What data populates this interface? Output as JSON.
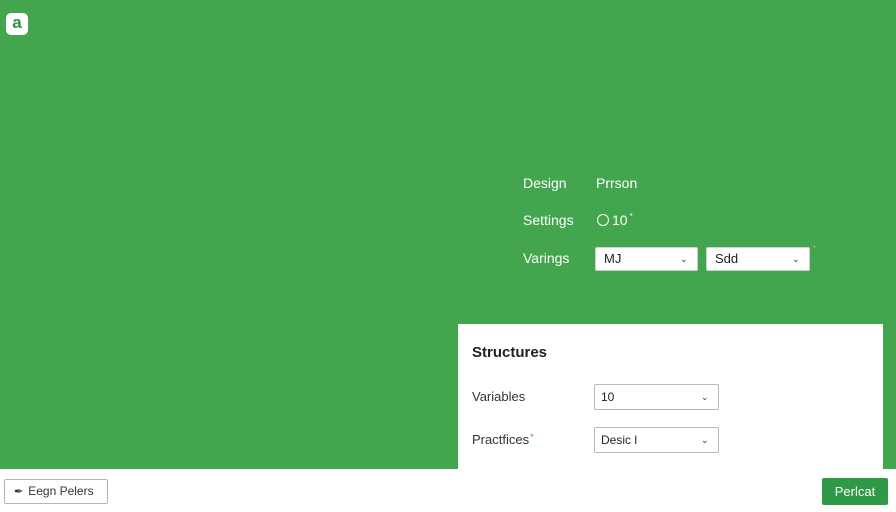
{
  "app": {
    "logo_letter": "a"
  },
  "form": {
    "design_label": "Design",
    "design_value": "Prrson",
    "settings_label": "Settings",
    "settings_value": "10",
    "settings_mark": "*",
    "variables_label": "Varings",
    "select_1": "MJ",
    "select_2": "Sdd",
    "tick_mark": "'"
  },
  "panel": {
    "title": "Structures",
    "variables_label": "Variables",
    "variables_value": "10",
    "practices_label": "Practfices",
    "practices_required": "*",
    "practices_value": "Desic l"
  },
  "footer": {
    "edit_label": "Eegn Pelers",
    "primary_label": "Perlcat"
  },
  "colors": {
    "background": "#43a64f",
    "primary_button": "#2e9a47",
    "required": "#d9534f"
  },
  "icons": {
    "logo": "logo-icon",
    "select_arrow": "chevron-down-icon",
    "edit": "pencil-icon",
    "radio": "circle-icon"
  }
}
